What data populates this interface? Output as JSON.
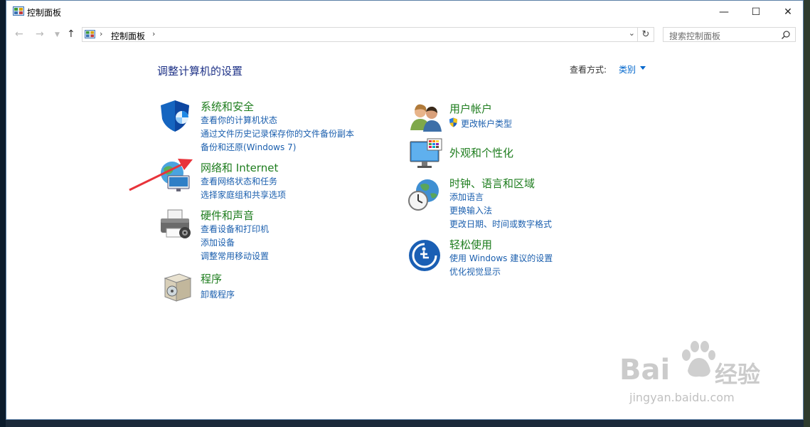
{
  "window": {
    "title": "控制面板",
    "controls": [
      "—",
      "☐",
      "✕"
    ]
  },
  "address": {
    "breadcrumb": "控制面板",
    "search_placeholder": "搜索控制面板"
  },
  "header": {
    "heading": "调整计算机的设置",
    "view_by_label": "查看方式:",
    "view_by_value": "类别"
  },
  "categories": {
    "system": {
      "title": "系统和安全",
      "links": [
        "查看你的计算机状态",
        "通过文件历史记录保存你的文件备份副本",
        "备份和还原(Windows 7)"
      ]
    },
    "network": {
      "title": "网络和 Internet",
      "links": [
        "查看网络状态和任务",
        "选择家庭组和共享选项"
      ]
    },
    "hardware": {
      "title": "硬件和声音",
      "links": [
        "查看设备和打印机",
        "添加设备",
        "调整常用移动设置"
      ]
    },
    "programs": {
      "title": "程序",
      "links": [
        "卸载程序"
      ]
    },
    "users": {
      "title": "用户帐户",
      "links": [
        "更改帐户类型"
      ]
    },
    "appearance": {
      "title": "外观和个性化",
      "links": []
    },
    "clock": {
      "title": "时钟、语言和区域",
      "links": [
        "添加语言",
        "更换输入法",
        "更改日期、时间或数字格式"
      ]
    },
    "ease": {
      "title": "轻松使用",
      "links": [
        "使用 Windows 建议的设置",
        "优化视觉显示"
      ]
    }
  },
  "watermark": {
    "brand": "Bai",
    "brand_cn": "经验",
    "url": "jingyan.baidu.com"
  },
  "colors": {
    "heading": "#1e3287",
    "category_title": "#1e7d1e",
    "link": "#1b5fae",
    "annotation_arrow": "#e8333a"
  }
}
